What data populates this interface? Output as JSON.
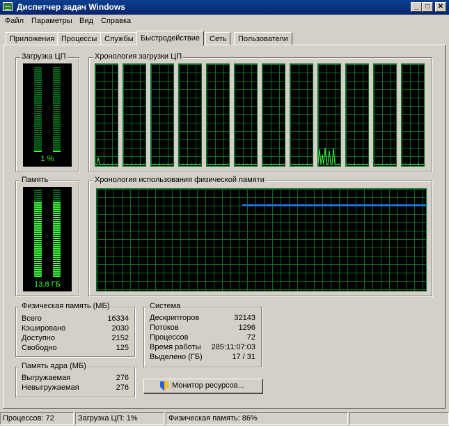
{
  "window": {
    "title": "Диспетчер задач Windows"
  },
  "title_buttons": [
    "_",
    "□",
    "✕"
  ],
  "menu": [
    "Файл",
    "Параметры",
    "Вид",
    "Справка"
  ],
  "tabs": [
    "Приложения",
    "Процессы",
    "Службы",
    "Быстродействие",
    "Сеть",
    "Пользователи"
  ],
  "active_tab": "Быстродействие",
  "cpu": {
    "title": "Загрузка ЦП",
    "value": "1 %",
    "level": 0.01
  },
  "cpu_history": {
    "title": "Хронология загрузки ЦП",
    "core_count": 12
  },
  "memory": {
    "title": "Память",
    "value": "13,8 ГБ",
    "level": 0.86
  },
  "memory_history": {
    "title": "Хронология использования физической памяти",
    "line_color": "#1e6fd0"
  },
  "physical_memory": {
    "title": "Физическая память (МБ)",
    "rows": [
      {
        "label": "Всего",
        "value": "16334"
      },
      {
        "label": "Кэшировано",
        "value": "2030"
      },
      {
        "label": "Доступно",
        "value": "2152"
      },
      {
        "label": "Свободно",
        "value": "125"
      }
    ]
  },
  "kernel_memory": {
    "title": "Память ядра (МБ)",
    "rows": [
      {
        "label": "Выгружаемая",
        "value": "276"
      },
      {
        "label": "Невыгружаемая",
        "value": "276"
      }
    ]
  },
  "system": {
    "title": "Система",
    "rows": [
      {
        "label": "Дескрипторов",
        "value": "32143"
      },
      {
        "label": "Потоков",
        "value": "1296"
      },
      {
        "label": "Процессов",
        "value": "72"
      },
      {
        "label": "Время работы",
        "value": "285:11:07:03"
      },
      {
        "label": "Выделено (ГБ)",
        "value": "17 / 31"
      }
    ]
  },
  "resource_monitor_button": {
    "label": "Монитор ресурсов...",
    "icon": "uac-shield-icon"
  },
  "status": {
    "processes": "Процессов: 72",
    "cpu": "Загрузка ЦП: 1%",
    "memory": "Физическая память: 86%"
  },
  "colors": {
    "graph_line": "#3fff3f",
    "grid": "#0b6b27",
    "led_on": "#3fff3f",
    "led_off": "#0a6b1e"
  }
}
